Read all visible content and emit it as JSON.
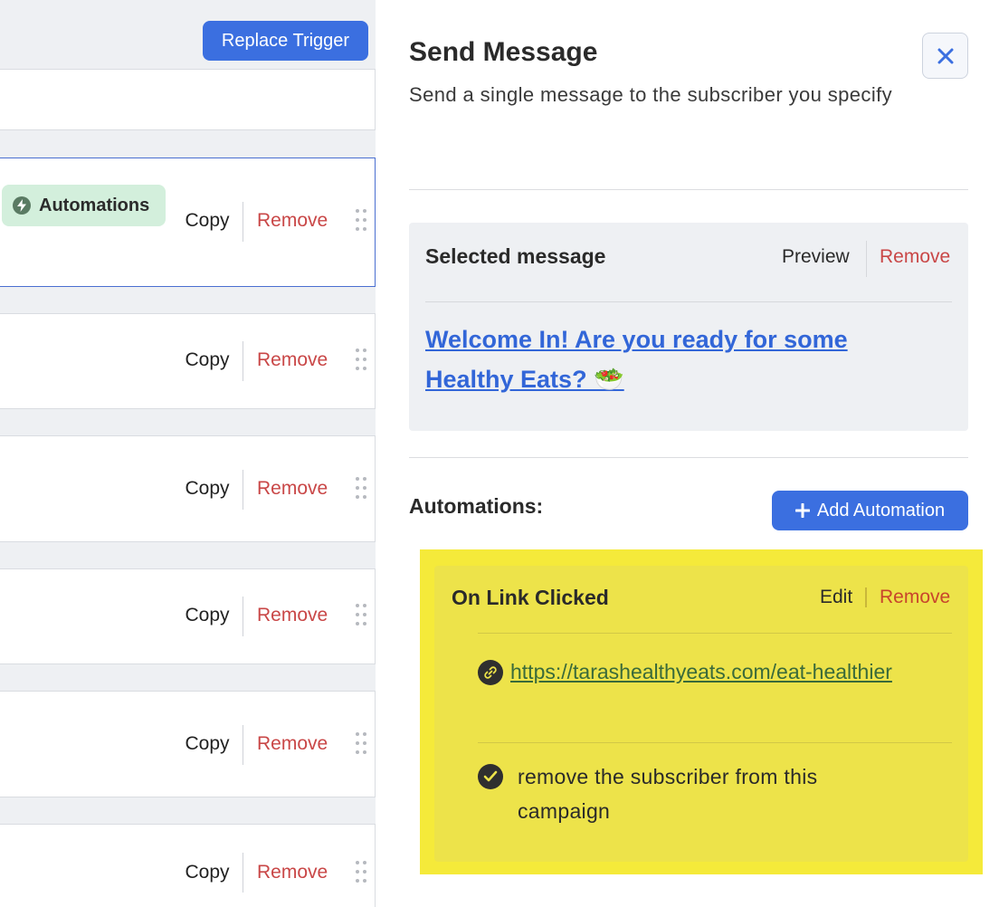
{
  "left": {
    "replace_trigger_label": "Replace Trigger",
    "automations_tag_label": "Automations",
    "steps": [
      {
        "copy": "Copy",
        "remove": "Remove"
      },
      {
        "copy": "Copy",
        "remove": "Remove"
      },
      {
        "copy": "Copy",
        "remove": "Remove"
      },
      {
        "copy": "Copy",
        "remove": "Remove"
      },
      {
        "copy": "Copy",
        "remove": "Remove"
      },
      {
        "copy": "Copy",
        "remove": "Remove"
      }
    ]
  },
  "panel": {
    "title": "Send Message",
    "subtitle": "Send a single message to the subscriber you specify",
    "close_icon": "close-icon",
    "selected_message": {
      "title": "Selected message",
      "preview_label": "Preview",
      "remove_label": "Remove",
      "message_title": "Welcome In! Are you ready for some Healthy Eats? 🥗"
    },
    "automations": {
      "label": "Automations:",
      "add_button_label": "Add Automation",
      "items": [
        {
          "title": "On Link Clicked",
          "edit_label": "Edit",
          "remove_label": "Remove",
          "link_url": "https://tarashealthyeats.com/eat-healthier",
          "action_text": "remove the subscriber from this campaign"
        }
      ]
    }
  },
  "colors": {
    "primary": "#3b6fe0",
    "danger": "#c94747",
    "highlight": "#f5ea3a",
    "automations_tag": "#d3efdc"
  }
}
